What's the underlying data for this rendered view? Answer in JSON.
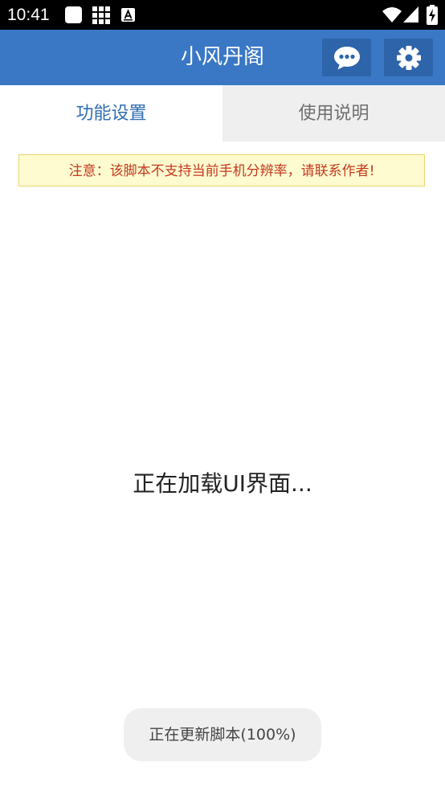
{
  "status_bar": {
    "time": "10:41",
    "icons": [
      "app-square-icon",
      "grid-icon",
      "keyboard-a-icon",
      "wifi-icon",
      "signal-icon",
      "battery-charging-icon"
    ]
  },
  "app_bar": {
    "title": "小风丹阁",
    "color": "#3a78c6",
    "buttons": [
      {
        "name": "chat-button",
        "icon": "chat-bubble-icon"
      },
      {
        "name": "settings-button",
        "icon": "gear-icon"
      }
    ]
  },
  "tabs": [
    {
      "label": "功能设置",
      "active": true
    },
    {
      "label": "使用说明",
      "active": false
    }
  ],
  "notice": {
    "text": "注意：该脚本不支持当前手机分辨率，请联系作者!"
  },
  "loading": {
    "text": "正在加载UI界面..."
  },
  "toast": {
    "text": "正在更新脚本(100%)"
  }
}
